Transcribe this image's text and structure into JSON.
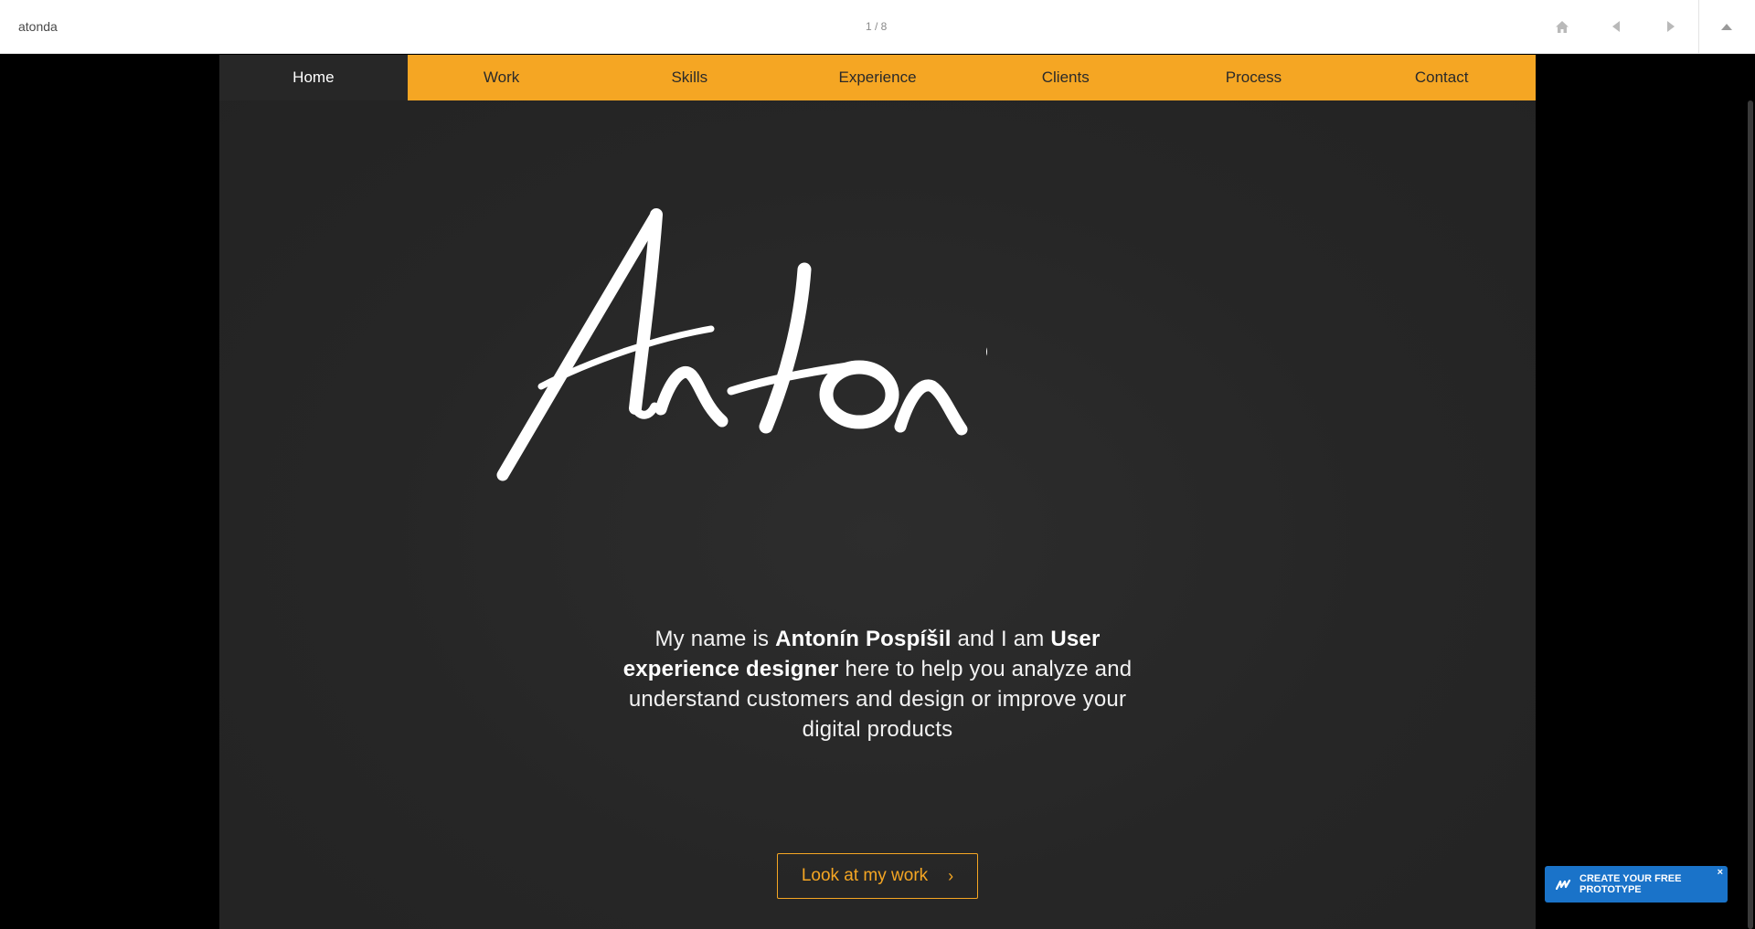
{
  "topbar": {
    "project_name": "atonda",
    "page_counter": "1 / 8"
  },
  "nav": {
    "items": [
      "Home",
      "Work",
      "Skills",
      "Experience",
      "Clients",
      "Process",
      "Contact"
    ],
    "active": "Home"
  },
  "hero": {
    "signature": "Antonín",
    "intro": {
      "p1": "My name is ",
      "name": "Antonín Pospíšil",
      "p2": " and I am ",
      "role": "User experience designer",
      "p3": " here to help you analyze and understand customers and design or improve your digital products"
    },
    "cta_label": "Look at my work",
    "cta_chevron": "›"
  },
  "promo": {
    "label": "CREATE YOUR FREE PROTOTYPE",
    "close": "×"
  },
  "colors": {
    "accent": "#f5a623",
    "nav_active_bg": "#272727",
    "frame_bg": "#272727",
    "promo_bg": "#1a73c9"
  },
  "icons": [
    "home-icon",
    "prev-arrow-icon",
    "next-arrow-icon",
    "collapse-up-icon",
    "marvel-logo-icon",
    "close-icon",
    "chevron-right-icon"
  ]
}
